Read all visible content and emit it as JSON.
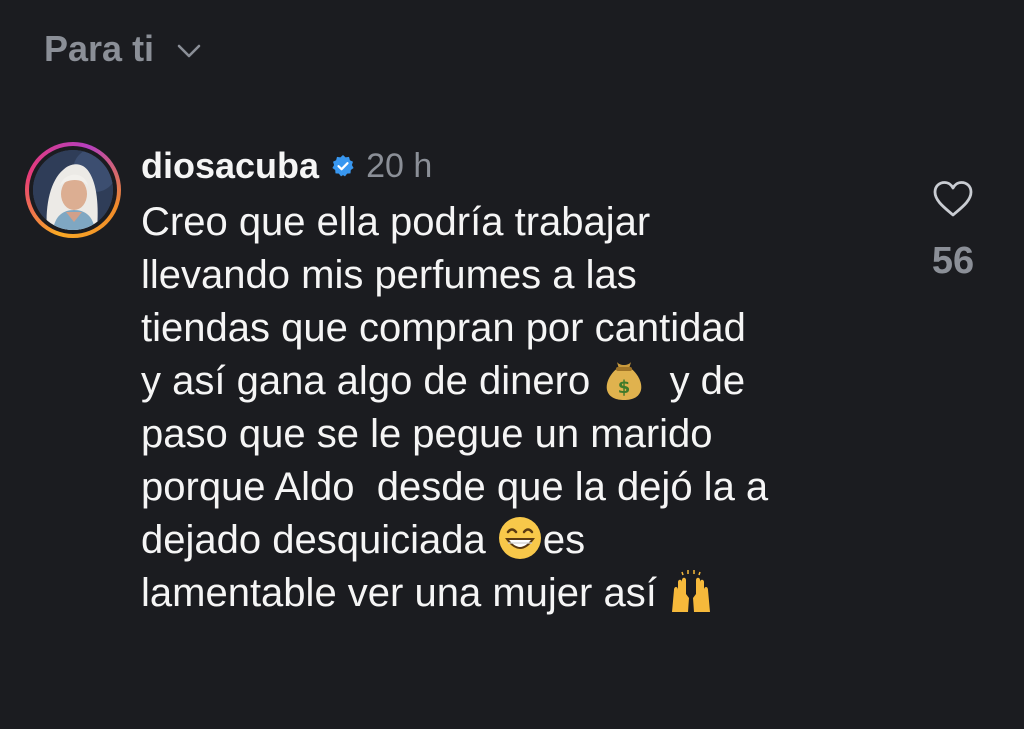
{
  "header": {
    "feed_title": "Para ti",
    "dropdown_icon": "chevron-down-icon"
  },
  "comment": {
    "username": "diosacuba",
    "verified_icon": "verified-badge-icon",
    "timestamp": "20 h",
    "text_segments": [
      "Creo que ella podría trabajar\nllevando mis perfumes a las\ntiendas que compran por cantidad\ny así gana algo de dinero ",
      "  y de\npaso que se le pegue un marido\nporque Aldo  desde que la dejó la a\ndejado desquiciada ",
      "es\nlamentable ver una mujer así "
    ],
    "emojis": [
      "money-bag-icon",
      "grinning-face-icon",
      "raised-hands-icon"
    ],
    "like_icon": "heart-icon",
    "like_count": "56"
  },
  "colors": {
    "background": "#1b1c20",
    "primary_text": "#f5f5f5",
    "secondary_text": "#8b8f97",
    "verified_blue": "#3897f0"
  }
}
